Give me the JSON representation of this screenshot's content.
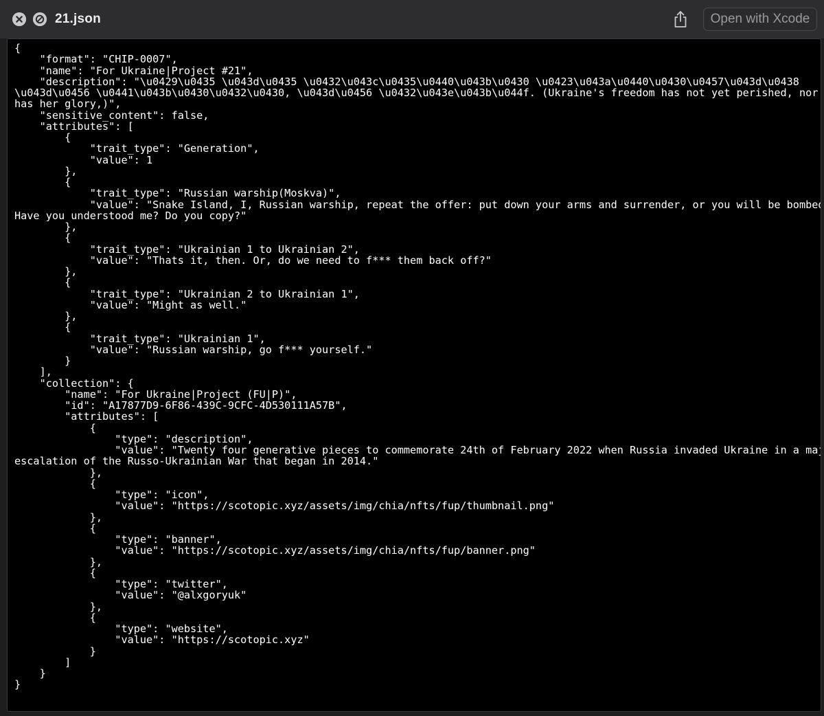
{
  "window": {
    "title": "21.json",
    "open_button_label": "Open with Xcode",
    "icons": {
      "close": "close-icon",
      "no-entry": "no-entry-icon",
      "share": "share-icon"
    }
  },
  "file_content": {
    "lines": [
      "{",
      "    \"format\": \"CHIP-0007\",",
      "    \"name\": \"For Ukraine|Project #21\",",
      "    \"description\": \"\\u0429\\u0435 \\u043d\\u0435 \\u0432\\u043c\\u0435\\u0440\\u043b\\u0430 \\u0423\\u043a\\u0440\\u0430\\u0457\\u043d\\u0438",
      "\\u043d\\u0456 \\u0441\\u043b\\u0430\\u0432\\u0430, \\u043d\\u0456 \\u0432\\u043e\\u043b\\u044f. (Ukraine's freedom has not yet perished, nor",
      "has her glory,)\",",
      "    \"sensitive_content\": false,",
      "    \"attributes\": [",
      "        {",
      "            \"trait_type\": \"Generation\",",
      "            \"value\": 1",
      "        },",
      "        {",
      "            \"trait_type\": \"Russian warship(Moskva)\",",
      "            \"value\": \"Snake Island, I, Russian warship, repeat the offer: put down your arms and surrender, or you will be bombed.",
      "Have you understood me? Do you copy?\"",
      "        },",
      "        {",
      "            \"trait_type\": \"Ukrainian 1 to Ukrainian 2\",",
      "            \"value\": \"Thats it, then. Or, do we need to f*** them back off?\"",
      "        },",
      "        {",
      "            \"trait_type\": \"Ukrainian 2 to Ukrainian 1\",",
      "            \"value\": \"Might as well.\"",
      "        },",
      "        {",
      "            \"trait_type\": \"Ukrainian 1\",",
      "            \"value\": \"Russian warship, go f*** yourself.\"",
      "        }",
      "    ],",
      "    \"collection\": {",
      "        \"name\": \"For Ukraine|Project (FU|P)\",",
      "        \"id\": \"A17877D9-6F86-439C-9CFC-4D530111A57B\",",
      "        \"attributes\": [",
      "            {",
      "                \"type\": \"description\",",
      "                \"value\": \"Twenty four generative pieces to commemorate 24th of February 2022 when Russia invaded Ukraine in a major",
      "escalation of the Russo-Ukrainian War that began in 2014.\"",
      "            },",
      "            {",
      "                \"type\": \"icon\",",
      "                \"value\": \"https://scotopic.xyz/assets/img/chia/nfts/fup/thumbnail.png\"",
      "            },",
      "            {",
      "                \"type\": \"banner\",",
      "                \"value\": \"https://scotopic.xyz/assets/img/chia/nfts/fup/banner.png\"",
      "            },",
      "            {",
      "                \"type\": \"twitter\",",
      "                \"value\": \"@alxgoryuk\"",
      "            },",
      "            {",
      "                \"type\": \"website\",",
      "                \"value\": \"https://scotopic.xyz\"",
      "            }",
      "        ]",
      "    }",
      "}"
    ]
  }
}
